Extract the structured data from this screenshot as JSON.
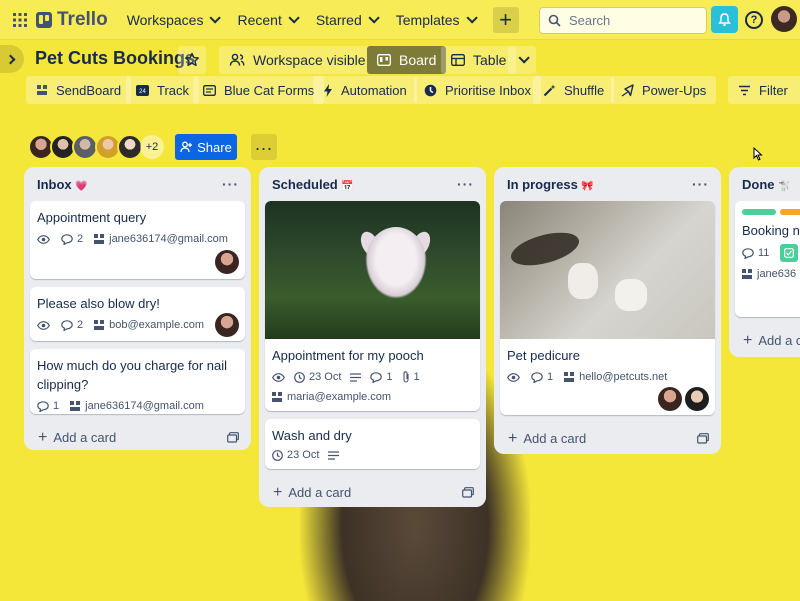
{
  "nav": {
    "logo": "Trello",
    "workspaces": "Workspaces",
    "recent": "Recent",
    "starred": "Starred",
    "templates": "Templates",
    "search_placeholder": "Search"
  },
  "board": {
    "title": "Pet Cuts Bookings",
    "visibility": "Workspace visible",
    "views": {
      "board": "Board",
      "table": "Table"
    }
  },
  "powerups": {
    "sendboard": "SendBoard",
    "track": "Track",
    "bluecat": "Blue Cat Forms",
    "automation": "Automation",
    "prioritise": "Prioritise Inbox",
    "shuffle": "Shuffle",
    "powerups": "Power-Ups",
    "filter": "Filter"
  },
  "members": {
    "more": "+2",
    "share": "Share"
  },
  "lists": {
    "inbox": {
      "title": "Inbox",
      "emoji": "💗",
      "add": "Add a card",
      "cards": [
        {
          "title": "Appointment query",
          "comments": "2",
          "email": "jane636174@gmail.com"
        },
        {
          "title": "Please also blow dry!",
          "comments": "2",
          "email": "bob@example.com"
        },
        {
          "title": "How much do you charge for nail clipping?",
          "comments": "1",
          "email": "jane636174@gmail.com"
        }
      ]
    },
    "scheduled": {
      "title": "Scheduled",
      "emoji": "📅",
      "add": "Add a card",
      "cards": [
        {
          "title": "Appointment for my pooch",
          "date": "23 Oct",
          "comments": "1",
          "attachments": "1",
          "email": "maria@example.com"
        },
        {
          "title": "Wash and dry",
          "date": "23 Oct"
        }
      ]
    },
    "inprogress": {
      "title": "In progress",
      "emoji": "🎀",
      "add": "Add a card",
      "cards": [
        {
          "title": "Pet pedicure",
          "comments": "1",
          "email": "hello@petcuts.net"
        }
      ]
    },
    "done": {
      "title": "Done",
      "emoji": "🐩",
      "add": "Add a ca",
      "cards": [
        {
          "title": "Booking ne",
          "comments": "11",
          "email": "jane636"
        }
      ]
    }
  },
  "colors": {
    "background": "#f5e63a",
    "share": "#0c66e4",
    "bell": "#2bc0d9",
    "active_view": "#7e7a38"
  }
}
